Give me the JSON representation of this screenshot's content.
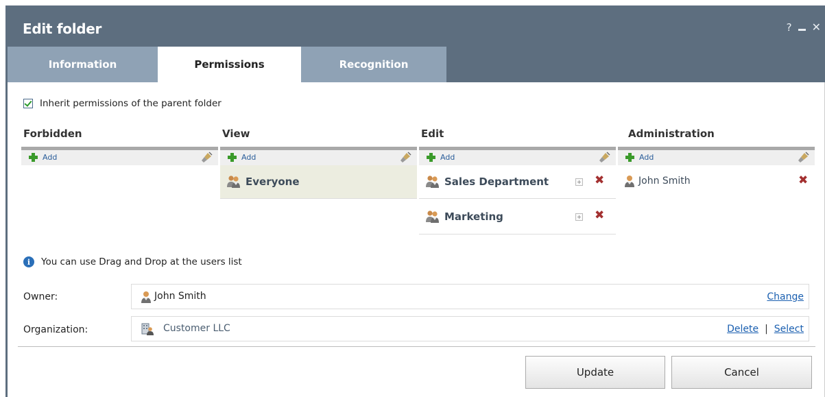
{
  "window": {
    "title": "Edit folder",
    "help_label": "?",
    "close_label": "✕"
  },
  "tabs": [
    {
      "label": "Information",
      "active": false
    },
    {
      "label": "Permissions",
      "active": true
    },
    {
      "label": "Recognition",
      "active": false
    }
  ],
  "inherit": {
    "label": "Inherit permissions of the parent folder",
    "checked": true
  },
  "columns": [
    {
      "header": "Forbidden",
      "add_label": "Add",
      "entries": []
    },
    {
      "header": "View",
      "add_label": "Add",
      "entries": [
        {
          "label": "Everyone",
          "type": "group",
          "highlight": true
        }
      ]
    },
    {
      "header": "Edit",
      "add_label": "Add",
      "entries": [
        {
          "label": "Sales Department",
          "type": "group"
        },
        {
          "label": "Marketing",
          "type": "group"
        }
      ]
    },
    {
      "header": "Administration",
      "add_label": "Add",
      "entries": [
        {
          "label": "John Smith",
          "type": "user"
        }
      ]
    }
  ],
  "hint": {
    "text": "You can use Drag and Drop at the users list",
    "icon": "info-icon"
  },
  "owner": {
    "label": "Owner:",
    "value": "John Smith",
    "change_link": "Change"
  },
  "organization": {
    "label": "Organization:",
    "value": "Customer LLC",
    "delete_link": "Delete",
    "separator": "|",
    "select_link": "Select"
  },
  "buttons": {
    "update": "Update",
    "cancel": "Cancel"
  },
  "colors": {
    "titlebar": "#5d6e7f",
    "tab_inactive": "#8fa2b5",
    "highlight_entry": "#ecede0",
    "delete_red": "#a33030",
    "link_blue": "#1a5fb0"
  }
}
